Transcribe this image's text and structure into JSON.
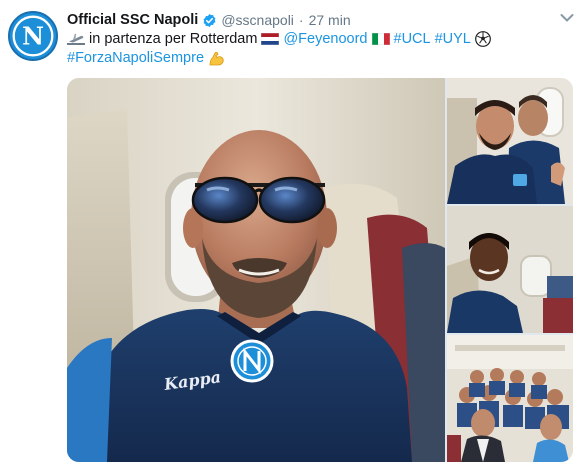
{
  "tweet": {
    "author_name": "Official SSC Napoli",
    "handle": "@sscnapoli",
    "separator": "·",
    "time": "27 min",
    "line1_text": " in partenza per Rotterdam",
    "mention": "@Feyenoord",
    "hashtag_ucl": "#UCL",
    "hashtag_uyl": "#UYL",
    "hashtag_forza": "#ForzaNapoliSempre",
    "avatar_letter": "N",
    "main_photo_jersey_text": "Kappa"
  },
  "icons": {
    "verified": "verified-badge-icon",
    "caret": "chevron-down-icon",
    "plane": "airplane-departure-emoji",
    "flag_nl": "netherlands-flag-emoji",
    "flag_it": "italy-flag-emoji",
    "ball": "soccer-ball-emoji",
    "muscle": "flexed-biceps-emoji"
  },
  "colors": {
    "link": "#1b95e0",
    "text": "#14171a",
    "muted": "#657786",
    "napoli_blue": "#1d8fd9"
  }
}
